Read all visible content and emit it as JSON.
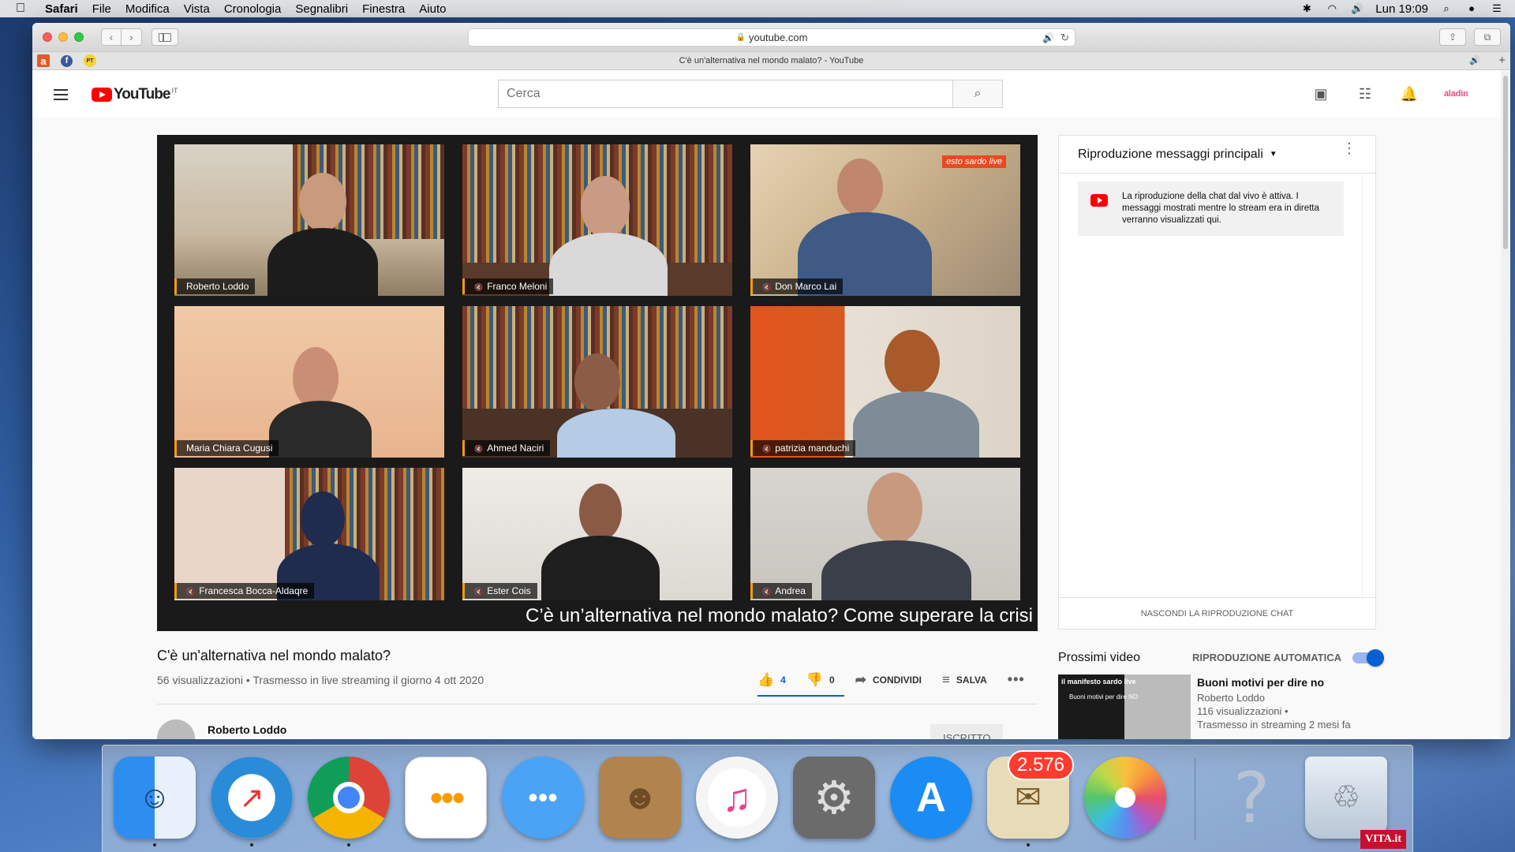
{
  "menubar": {
    "app": "Safari",
    "items": [
      "File",
      "Modifica",
      "Vista",
      "Cronologia",
      "Segnalibri",
      "Finestra",
      "Aiuto"
    ],
    "clock": "Lun 19:09"
  },
  "browser": {
    "url": "youtube.com",
    "tab_title": "C'è un'alternativa nel mondo malato? - YouTube",
    "favorites": [
      "a",
      "f",
      "PT"
    ]
  },
  "youtube": {
    "logo": "YouTube",
    "country": "IT",
    "search_placeholder": "Cerca",
    "account_label": "aladin"
  },
  "player": {
    "caption": "C’è un’alternativa nel mondo malato? Come superare la crisi",
    "brand": "esto sardo live",
    "participants": [
      {
        "name": "Roberto Loddo",
        "muted": false
      },
      {
        "name": "Franco Meloni",
        "muted": true
      },
      {
        "name": "Don Marco Lai",
        "muted": true
      },
      {
        "name": "Maria Chiara Cugusi",
        "muted": false
      },
      {
        "name": "Ahmed Naciri",
        "muted": true
      },
      {
        "name": "patrizia manduchi",
        "muted": true
      },
      {
        "name": "Francesca Bocca-Aldaqre",
        "muted": true
      },
      {
        "name": "Ester Cois",
        "muted": true
      },
      {
        "name": "Andrea",
        "muted": true
      }
    ]
  },
  "video": {
    "title": "C'è un'alternativa nel mondo malato?",
    "meta": "56 visualizzazioni • Trasmesso in live streaming il giorno 4 ott 2020",
    "likes": "4",
    "dislikes": "0",
    "share_label": "CONDIVIDI",
    "save_label": "SALVA",
    "channel": "Roberto Loddo",
    "subscribe_label": "ISCRITTO"
  },
  "chat": {
    "header": "Riproduzione messaggi principali",
    "notice": "La riproduzione della chat dal vivo è attiva. I messaggi mostrati mentre lo stream era in diretta verranno visualizzati qui.",
    "footer": "NASCONDI LA RIPRODUZIONE CHAT"
  },
  "upnext": {
    "label": "Prossimi video",
    "autoplay_label": "RIPRODUZIONE AUTOMATICA",
    "autoplay_on": true,
    "card": {
      "title": "Buoni motivi per dire no",
      "channel": "Roberto Loddo",
      "views": "116 visualizzazioni •",
      "when": "Trasmesso in streaming 2 mesi fa",
      "thumb_title": "il manifesto sardo live",
      "thumb_sub": "Buoni motivi per dire NO"
    }
  },
  "dock": {
    "apps": [
      "finder",
      "safari",
      "chrome",
      "reminders",
      "messages",
      "contacts",
      "itunes",
      "system-preferences",
      "app-store",
      "mail",
      "photos",
      "unknown",
      "trash"
    ],
    "mail_badge": "2.576",
    "corner_logo": "VITA.it"
  },
  "colors": {
    "youtube_red": "#ff0000",
    "link_blue": "#065fd4",
    "name_tag_accent": "#f39c12"
  }
}
